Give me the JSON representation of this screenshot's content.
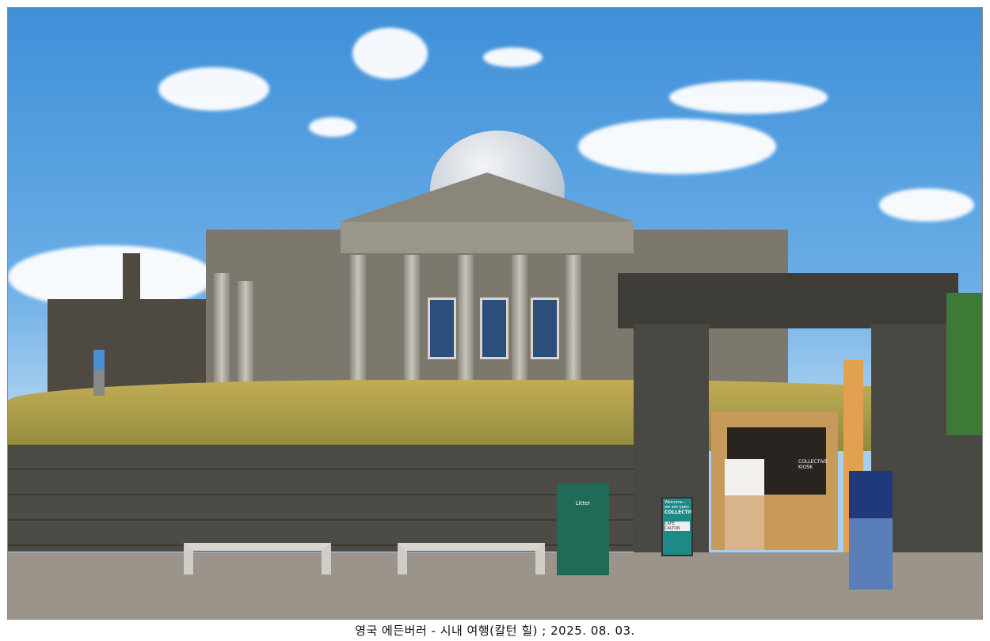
{
  "caption": "영국 에든버러 - 시내 여행(칼턴 힐) ; 2025. 08. 03.",
  "scene": {
    "litter_bin_label": "Litter",
    "sign_brand": "COLLECTIVE",
    "sign_welcome": "Welcome – we are open",
    "sign_cafe": "CAFE CALTON",
    "kiosk_label": "COLLECTIVE KIOSK"
  },
  "colors": {
    "sky": "#4a97dc",
    "grass": "#b8a54e",
    "bin": "#1f6b58"
  }
}
